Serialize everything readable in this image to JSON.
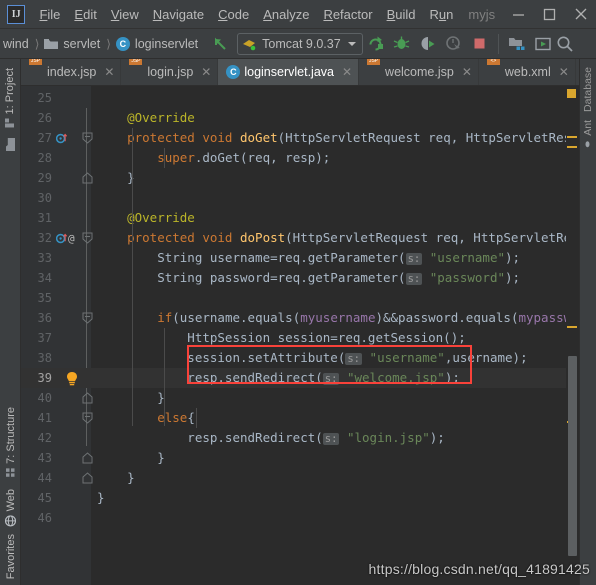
{
  "window": {
    "title": "myjs",
    "logo_text": "IJ",
    "minimize_label": "—",
    "maximize_label": "□",
    "close_label": "✕"
  },
  "menubar": {
    "items": [
      {
        "label": "File",
        "mnemonic": "F"
      },
      {
        "label": "Edit",
        "mnemonic": "E"
      },
      {
        "label": "View",
        "mnemonic": "V"
      },
      {
        "label": "Navigate",
        "mnemonic": "N"
      },
      {
        "label": "Code",
        "mnemonic": "C"
      },
      {
        "label": "Analyze",
        "mnemonic": "A"
      },
      {
        "label": "Refactor",
        "mnemonic": "R"
      },
      {
        "label": "Build",
        "mnemonic": "B"
      },
      {
        "label": "Run",
        "mnemonic": "u"
      }
    ]
  },
  "navbar": {
    "breadcrumbs": [
      {
        "label": "wind",
        "icon": "none"
      },
      {
        "label": "servlet",
        "icon": "folder-icon"
      },
      {
        "label": "loginservlet",
        "icon": "class-icon"
      }
    ],
    "run_config": "Tomcat 9.0.37",
    "buttons": [
      {
        "name": "rerun-button",
        "label": "Rerun"
      },
      {
        "name": "debug-button",
        "label": "Debug"
      },
      {
        "name": "run-with-coverage-button",
        "label": "Run with Coverage"
      },
      {
        "name": "profile-button",
        "label": "Profile"
      },
      {
        "name": "stop-button",
        "label": "Stop"
      },
      {
        "name": "open-project-structure-button",
        "label": "Project Structure"
      },
      {
        "name": "update-application-button",
        "label": "Update Application"
      },
      {
        "name": "search-everywhere-button",
        "label": "Search"
      }
    ]
  },
  "left_rail": {
    "top_items": [
      {
        "label": "1: Project",
        "icon": "project-icon",
        "selected": false
      },
      {
        "label": "",
        "icon": "folder-icon",
        "selected": false
      }
    ],
    "bottom_items": [
      {
        "label": "7: Structure",
        "icon": "structure-icon"
      },
      {
        "label": "Web",
        "icon": "web-icon"
      },
      {
        "label": "Favorites",
        "icon": "favorites-icon"
      }
    ]
  },
  "right_rail": {
    "items": [
      {
        "label": "Database",
        "icon": "database-icon"
      },
      {
        "label": "Ant",
        "icon": "ant-icon"
      }
    ]
  },
  "tabs": [
    {
      "label": "index.jsp",
      "icon": "jsp-file-icon",
      "active": false,
      "closable": true
    },
    {
      "label": "login.jsp",
      "icon": "jsp-file-icon",
      "active": false,
      "closable": true
    },
    {
      "label": "loginservlet.java",
      "icon": "java-class-icon",
      "active": true,
      "closable": true
    },
    {
      "label": "welcome.jsp",
      "icon": "jsp-file-icon",
      "active": false,
      "closable": true
    },
    {
      "label": "web.xml",
      "icon": "xml-file-icon",
      "active": false,
      "closable": true
    }
  ],
  "editor": {
    "current_line": 39,
    "first_line": 25,
    "lines": [
      {
        "n": 25,
        "text": ""
      },
      {
        "n": 26,
        "text": "        @Override",
        "type": "annotation"
      },
      {
        "n": 27,
        "text": "        protected void doGet(HttpServletRequest req, HttpServletResponse re"
      },
      {
        "n": 28,
        "text": "            super.doGet(req, resp);"
      },
      {
        "n": 29,
        "text": "        }"
      },
      {
        "n": 30,
        "text": ""
      },
      {
        "n": 31,
        "text": "        @Override",
        "type": "annotation"
      },
      {
        "n": 32,
        "text": "        protected void doPost(HttpServletRequest req, HttpServletResponse r"
      },
      {
        "n": 33,
        "text": "            String username=req.getParameter( s: \"username\");"
      },
      {
        "n": 34,
        "text": "            String password=req.getParameter( s: \"password\");"
      },
      {
        "n": 35,
        "text": ""
      },
      {
        "n": 36,
        "text": "            if(username.equals(myusername)&&password.equals(mypassword)){"
      },
      {
        "n": 37,
        "text": "                HttpSession session=req.getSession();"
      },
      {
        "n": 38,
        "text": "                session.setAttribute( s: \"username\",username);"
      },
      {
        "n": 39,
        "text": "                resp.sendRedirect( s: \"welcome.jsp\");"
      },
      {
        "n": 40,
        "text": "            }"
      },
      {
        "n": 41,
        "text": "            else{"
      },
      {
        "n": 42,
        "text": "                resp.sendRedirect( s: \"login.jsp\");"
      },
      {
        "n": 43,
        "text": "            }"
      },
      {
        "n": 44,
        "text": "        }"
      },
      {
        "n": 45,
        "text": "    }"
      },
      {
        "n": 46,
        "text": ""
      }
    ],
    "parameter_hint": "s:",
    "annotation_box": {
      "color": "#f9423a",
      "target_line": 39,
      "target_text": "resp.sendRedirect( s: \"welcome.jsp\");"
    },
    "gutter_markers": [
      {
        "line": 27,
        "icons": [
          "override-method-icon"
        ]
      },
      {
        "line": 32,
        "icons": [
          "override-method-icon",
          "annotation-icon"
        ]
      },
      {
        "line": 39,
        "icons": [
          "intention-bulb-icon"
        ]
      }
    ]
  },
  "watermark": "https://blog.csdn.net/qq_41891425",
  "colors": {
    "accent_red": "#f9423a",
    "keyword": "#cc7832",
    "string": "#6a8759",
    "annotation": "#bbb529",
    "method": "#ffc66d",
    "field": "#9876aa",
    "text": "#a9b7c6",
    "editor_bg": "#2b2b2b",
    "chrome_bg": "#3c3f41"
  }
}
